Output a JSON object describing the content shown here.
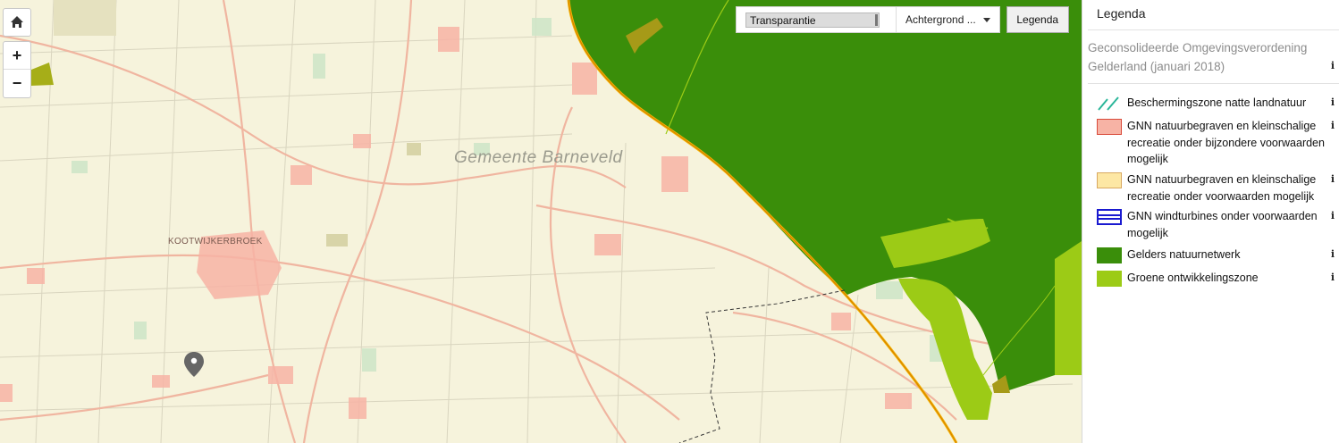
{
  "map": {
    "labels": {
      "gemeente": "Gemeente Barneveld",
      "place": "KOOTWIJKERBROEK"
    },
    "controls": {
      "home_icon": "home-icon",
      "zoom_in": "+",
      "zoom_out": "−"
    },
    "colors": {
      "base": "#f6f3dc",
      "natuurnetwerk": "#3a8e0a",
      "ontwikkelingszone": "#9ccb16",
      "natuurbegraven_bijzonder": "#f7b3a5",
      "natuurbegraven": "#fde7a4",
      "road": "#f0b5a0",
      "province_border": "#f3b400"
    }
  },
  "toolbar": {
    "transparency_label": "Transparantie",
    "background_label": "Achtergrond ...",
    "legend_button": "Legenda"
  },
  "legend": {
    "title": "Legenda",
    "source": "Geconsolideerde Omgevingsverordening Gelderland (januari 2018)",
    "info_symbol": "i",
    "items": [
      {
        "label": "Beschermingszone natte landnatuur",
        "swatch": "hatch-teal",
        "color": "#2bb69a"
      },
      {
        "label": "GNN natuurbegraven en kleinschalige recreatie onder bijzondere voorwaarden mogelijk",
        "swatch": "fill",
        "color": "#f7b3a5",
        "border": "#d94a3a"
      },
      {
        "label": "GNN natuurbegraven en kleinschalige recreatie onder voorwaarden mogelijk",
        "swatch": "fill",
        "color": "#fde7a4",
        "border": "#d8a860"
      },
      {
        "label": "GNN windturbines onder voorwaarden mogelijk",
        "swatch": "lines-blue",
        "color": "#1a1ad0"
      },
      {
        "label": "Gelders natuurnetwerk",
        "swatch": "fill",
        "color": "#3a8e0a"
      },
      {
        "label": "Groene ontwikkelingszone",
        "swatch": "fill",
        "color": "#9ccb16"
      }
    ]
  }
}
